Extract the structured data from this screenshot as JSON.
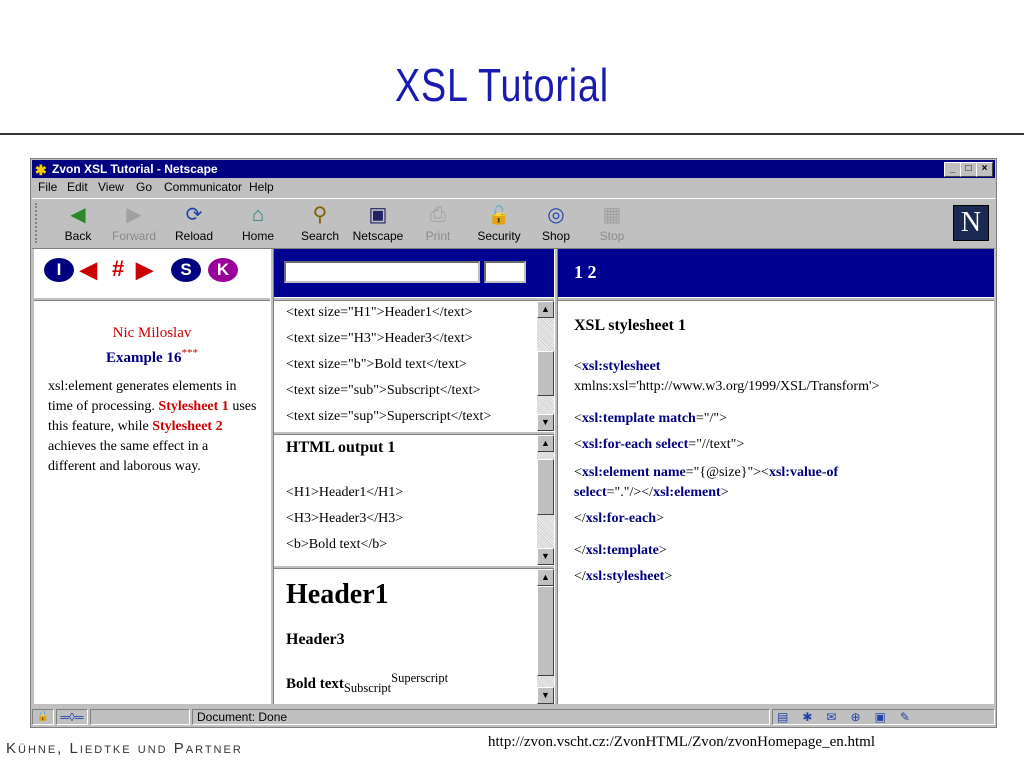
{
  "slide": {
    "title": "XSL  Tutorial",
    "footer_left": "Kühne, Liedtke und Partner",
    "footer_url": "http://zvon.vscht.cz:/ZvonHTML/Zvon/zvonHomepage_en.html"
  },
  "window": {
    "title": "Zvon XSL Tutorial - Netscape",
    "min": "_",
    "max": "□",
    "close": "×"
  },
  "menu": [
    "File",
    "Edit",
    "View",
    "Go",
    "Communicator",
    "Help"
  ],
  "toolbar": [
    {
      "label": "Back",
      "icon": "back-arrow-icon",
      "glyph": "◀",
      "enabled": true
    },
    {
      "label": "Forward",
      "icon": "forward-arrow-icon",
      "glyph": "▶",
      "enabled": false
    },
    {
      "label": "Reload",
      "icon": "reload-icon",
      "glyph": "⟳",
      "enabled": true
    },
    {
      "label": "Home",
      "icon": "home-icon",
      "glyph": "⌂",
      "enabled": true
    },
    {
      "label": "Search",
      "icon": "search-icon",
      "glyph": "⚲",
      "enabled": true
    },
    {
      "label": "Netscape",
      "icon": "netscape-icon",
      "glyph": "▣",
      "enabled": true
    },
    {
      "label": "Print",
      "icon": "print-icon",
      "glyph": "⎙",
      "enabled": false
    },
    {
      "label": "Security",
      "icon": "lock-icon",
      "glyph": "🔓",
      "enabled": true
    },
    {
      "label": "Shop",
      "icon": "shop-icon",
      "glyph": "◎",
      "enabled": true
    },
    {
      "label": "Stop",
      "icon": "stop-icon",
      "glyph": "▦",
      "enabled": false
    }
  ],
  "brand_logo": "N",
  "nav_buttons": [
    {
      "label": "I",
      "color": "#000080"
    },
    {
      "label": "◀",
      "color": "#cc0000"
    },
    {
      "label": "#",
      "color": "#cc0000"
    },
    {
      "label": "▶",
      "color": "#cc0000"
    },
    {
      "label": "S",
      "color": "#000080"
    },
    {
      "label": "K",
      "color": "#990099"
    }
  ],
  "left": {
    "author": "Nic Miloslav",
    "example": "Example 16",
    "example_sup": "***",
    "desc_1": "xsl:element generates elements in time of processing. ",
    "link_1": "Stylesheet 1",
    "desc_2": " uses this feature, while ",
    "link_2": "Stylesheet 2",
    "desc_3": " achieves the same effect in a different and laborous way."
  },
  "source_lines": [
    "<text size=\"H1\">Header1</text>",
    "<text size=\"H3\">Header3</text>",
    "<text size=\"b\">Bold text</text>",
    "<text size=\"sub\">Subscript</text>",
    "<text size=\"sup\">Superscript</text>"
  ],
  "html_output": {
    "heading": "HTML output 1",
    "lines": [
      "<H1>Header1</H1>",
      "<H3>Header3</H3>",
      "<b>Bold text</b>"
    ]
  },
  "render": {
    "h1": "Header1",
    "h3": "Header3",
    "bold": "Bold text",
    "sub": "Subscript",
    "sup": "Superscript"
  },
  "page_number": "1 2",
  "stylesheet": {
    "heading": "XSL stylesheet 1",
    "lines": [
      {
        "open": "<",
        "kw": "xsl:stylesheet",
        "rest": ""
      },
      {
        "open": "",
        "kw": "",
        "rest": "xmlns:xsl='http://www.w3.org/1999/XSL/Transform'>"
      },
      {
        "open": "<",
        "kw": "xsl:template",
        "mid": " ",
        "kw2": "match",
        "rest": "=\"/\">"
      },
      {
        "open": "<",
        "kw": "xsl:for-each",
        "mid": " ",
        "kw2": "select",
        "rest": "=\"//text\">"
      },
      {
        "open": "<",
        "kw": "xsl:element",
        "mid": " ",
        "kw2": "name",
        "rest": "=\"{@size}\"><",
        "kw3": "xsl:value-of"
      },
      {
        "open": "",
        "kw": "select",
        "rest": "=\".\"/></",
        "kw3": "xsl:element",
        "tail": ">"
      },
      {
        "open": "</",
        "kw": "xsl:for-each",
        "rest": ">"
      },
      {
        "open": "</",
        "kw": "xsl:template",
        "rest": ">"
      },
      {
        "open": "</",
        "kw": "xsl:stylesheet",
        "rest": ">"
      }
    ]
  },
  "status": {
    "text": "Document: Done"
  }
}
